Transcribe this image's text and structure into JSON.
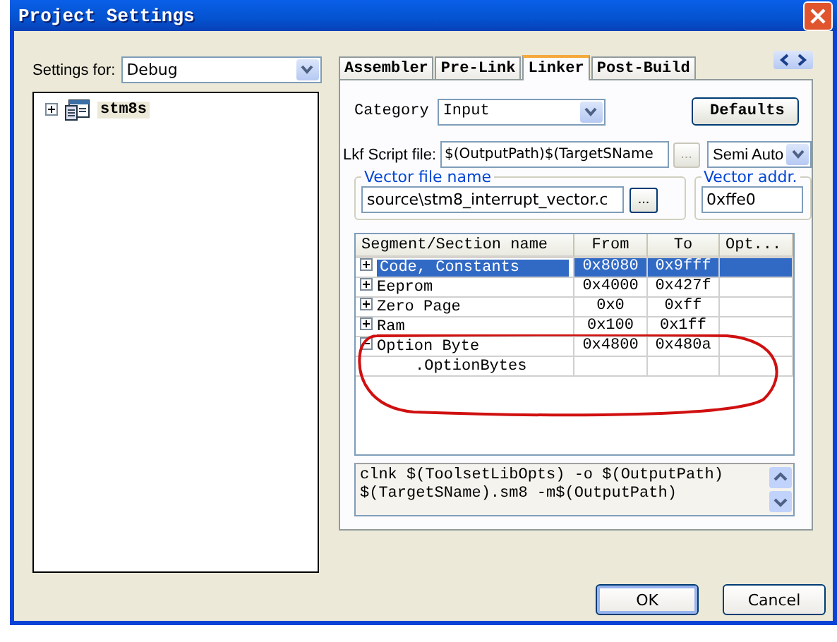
{
  "window": {
    "title": "Project Settings"
  },
  "settings_for": {
    "label": "Settings for:",
    "value": "Debug"
  },
  "tree": [
    {
      "label": "stm8s",
      "expanded": false
    }
  ],
  "tabs": [
    {
      "label": "Assembler",
      "selected": false
    },
    {
      "label": "Pre-Link",
      "selected": false
    },
    {
      "label": "Linker",
      "selected": true
    },
    {
      "label": "Post-Build",
      "selected": false
    }
  ],
  "category": {
    "label": "Category",
    "value": "Input"
  },
  "defaults_button": "Defaults",
  "lkf": {
    "label": "Lkf Script file:",
    "value": "$(OutputPath)$(TargetSName",
    "browse": "...",
    "browse_disabled": true,
    "mode": "Semi Auto"
  },
  "vector_file": {
    "legend": "Vector file name",
    "value": "source\\stm8_interrupt_vector.c",
    "browse": "..."
  },
  "vector_addr": {
    "legend": "Vector addr.",
    "value": "0xffe0"
  },
  "segments": {
    "columns": [
      "Segment/Section name",
      "From",
      "To",
      "Opt..."
    ],
    "rows": [
      {
        "name": "Code, Constants",
        "from": "0x8080",
        "to": "0x9fff",
        "expanded": false,
        "selected": true
      },
      {
        "name": "Eeprom",
        "from": "0x4000",
        "to": "0x427f",
        "expanded": false,
        "selected": false
      },
      {
        "name": "Zero Page",
        "from": "0x0",
        "to": "0xff",
        "expanded": false,
        "selected": false
      },
      {
        "name": "Ram",
        "from": "0x100",
        "to": "0x1ff",
        "expanded": false,
        "selected": false
      },
      {
        "name": "Option Byte",
        "from": "0x4800",
        "to": "0x480a",
        "expanded": true,
        "selected": false,
        "children": [
          {
            "name": ".OptionBytes"
          }
        ]
      }
    ]
  },
  "command": [
    "clnk $(ToolsetLibOpts) -o $(OutputPath)",
    "$(TargetSName).sm8 -m$(OutputPath)"
  ],
  "buttons": [
    {
      "label": "OK",
      "kind": "default"
    },
    {
      "label": "Cancel",
      "kind": "normal"
    }
  ]
}
